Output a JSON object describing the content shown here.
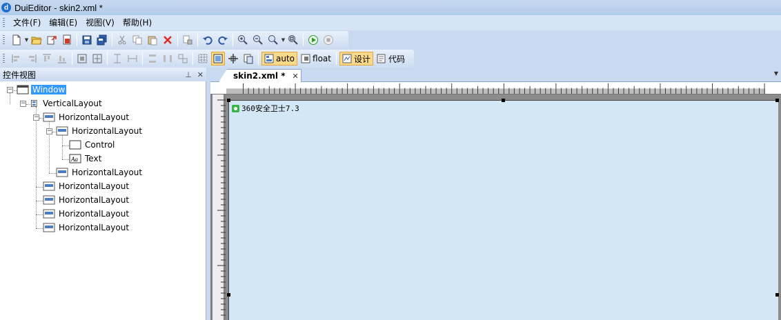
{
  "window": {
    "title": "DuiEditor - skin2.xml *"
  },
  "menu": [
    "文件(F)",
    "编辑(E)",
    "视图(V)",
    "帮助(H)"
  ],
  "toolbar2": {
    "auto_label": "auto",
    "float_label": "float",
    "design_label": "设计",
    "code_label": "代码"
  },
  "panel": {
    "title": "控件视图",
    "pin": "ᅟ",
    "close": "✕"
  },
  "tree": [
    {
      "label": "Window",
      "level": 0,
      "selected": true
    },
    {
      "label": "VerticalLayout",
      "level": 1
    },
    {
      "label": "HorizontalLayout",
      "level": 2
    },
    {
      "label": "HorizontalLayout",
      "level": 3
    },
    {
      "label": "Control",
      "level": 4
    },
    {
      "label": "Text",
      "level": 4
    },
    {
      "label": "HorizontalLayout",
      "level": 3
    },
    {
      "label": "HorizontalLayout",
      "level": 2
    },
    {
      "label": "HorizontalLayout",
      "level": 2
    },
    {
      "label": "HorizontalLayout",
      "level": 2
    },
    {
      "label": "HorizontalLayout",
      "level": 2
    }
  ],
  "tab": {
    "title": "skin2.xml *",
    "close": "✕"
  },
  "canvas": {
    "caption": "360安全卫士7.3"
  },
  "colors": {
    "selection": "#3399ff",
    "canvas": "#d3e7f4",
    "active_button": "#fbd98a"
  }
}
